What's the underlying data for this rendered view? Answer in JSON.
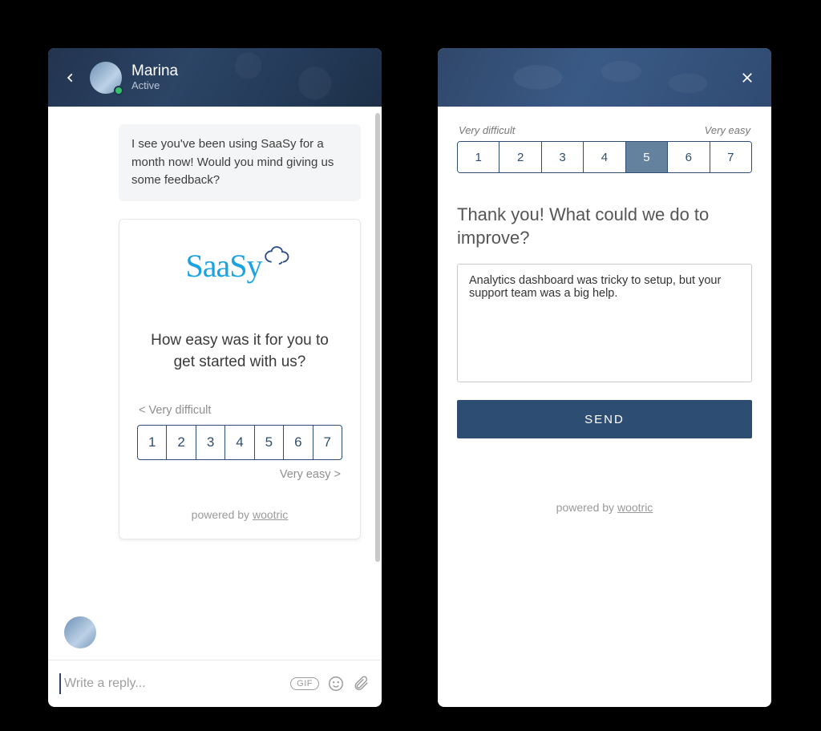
{
  "chat": {
    "agent": {
      "name": "Marina",
      "status": "Active"
    },
    "message": "I see you've been using SaaSy for a month now! Would you mind giving us some feedback?",
    "reply_placeholder": "Write a reply...",
    "gif_label": "GIF"
  },
  "survey": {
    "brand": "SaaSy",
    "question": "How easy was it for you to get started with us?",
    "scale_min_label": "< Very difficult",
    "scale_max_label": "Very easy >",
    "scale_values": [
      "1",
      "2",
      "3",
      "4",
      "5",
      "6",
      "7"
    ],
    "powered_by_prefix": "powered by ",
    "powered_by_link": "wootric"
  },
  "followup": {
    "scale_min_label": "Very difficult",
    "scale_max_label": "Very easy",
    "scale_values": [
      "1",
      "2",
      "3",
      "4",
      "5",
      "6",
      "7"
    ],
    "selected_index": 4,
    "question": "Thank you! What could we do to improve?",
    "textarea_value": "Analytics dashboard was tricky to setup, but your support team was a big help.",
    "send_label": "SEND",
    "powered_by_prefix": "powered by ",
    "powered_by_link": "wootric"
  }
}
